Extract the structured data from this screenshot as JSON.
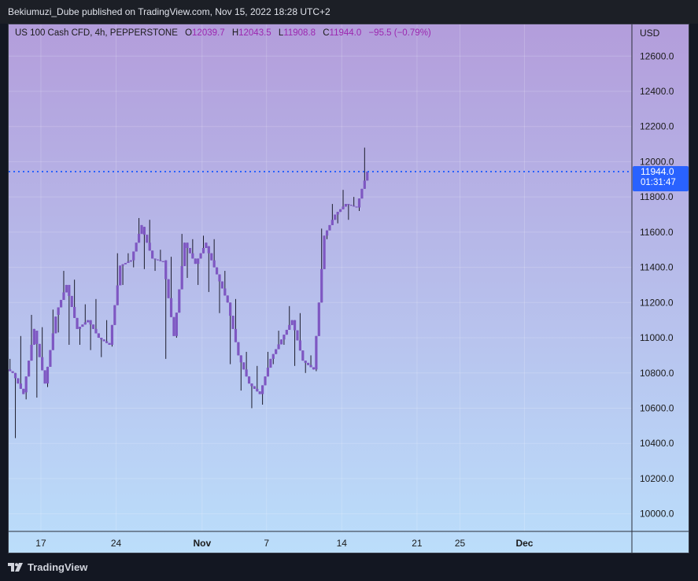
{
  "header": {
    "publisher": "Bekiumuzi_Dube published on TradingView.com, Nov 15, 2022 18:28 UTC+2"
  },
  "legend": {
    "symbol": "US 100 Cash CFD, 4h, PEPPERSTONE",
    "open_key": "O",
    "open": "12039.7",
    "high_key": "H",
    "high": "12043.5",
    "low_key": "L",
    "low": "11908.8",
    "close_key": "C",
    "close": "11944.0",
    "change": "−95.5 (−0.79%)"
  },
  "price_axis": {
    "currency": "USD",
    "last_price_label": "11944.0",
    "countdown_label": "01:31:47"
  },
  "footer": {
    "brand": "TradingView"
  },
  "colors": {
    "bg_top": "#b39ddb",
    "bg_bottom": "#bbdefb",
    "candle": "#7e57c2",
    "wick": "#1b1b2b",
    "last_price": "#2962ff",
    "legend_values": "#9c27b0"
  },
  "chart_data": {
    "type": "candlestick",
    "title": "US 100 Cash CFD, 4h, PEPPERSTONE",
    "ylabel": "USD",
    "ylim": [
      9900,
      12780
    ],
    "y_ticks": [
      10000,
      10200,
      10400,
      10600,
      10800,
      11000,
      11200,
      11400,
      11600,
      11800,
      12000,
      12200,
      12400,
      12600
    ],
    "x_ticks": [
      {
        "label": "17",
        "day": 17
      },
      {
        "label": "24",
        "day": 24
      },
      {
        "label": "Nov",
        "day": 32
      },
      {
        "label": "7",
        "day": 38
      },
      {
        "label": "14",
        "day": 45
      },
      {
        "label": "21",
        "day": 52
      },
      {
        "label": "25",
        "day": 56
      },
      {
        "label": "Dec",
        "day": 62
      }
    ],
    "grid": true,
    "last_price": 11944.0,
    "candles_daily_approx": [
      {
        "day": 14,
        "open": 10840,
        "high": 10880,
        "low": 10780,
        "close": 10800
      },
      {
        "day": 15,
        "open": 10800,
        "high": 11010,
        "low": 10430,
        "close": 10680
      },
      {
        "day": 16,
        "open": 10690,
        "high": 11130,
        "low": 10650,
        "close": 11050
      },
      {
        "day": 17,
        "open": 11040,
        "high": 11060,
        "low": 10660,
        "close": 10740
      },
      {
        "day": 18,
        "open": 10740,
        "high": 11160,
        "low": 10720,
        "close": 11120
      },
      {
        "day": 19,
        "open": 11130,
        "high": 11380,
        "low": 11030,
        "close": 11300
      },
      {
        "day": 20,
        "open": 11300,
        "high": 11330,
        "low": 10960,
        "close": 11050
      },
      {
        "day": 21,
        "open": 11050,
        "high": 11190,
        "low": 10960,
        "close": 11100
      },
      {
        "day": 22,
        "open": 11100,
        "high": 11220,
        "low": 10930,
        "close": 11000
      },
      {
        "day": 23,
        "open": 11000,
        "high": 11100,
        "low": 10890,
        "close": 10960
      },
      {
        "day": 24,
        "open": 10960,
        "high": 11480,
        "low": 10950,
        "close": 11410
      },
      {
        "day": 25,
        "open": 11410,
        "high": 11480,
        "low": 11300,
        "close": 11440
      },
      {
        "day": 26,
        "open": 11440,
        "high": 11680,
        "low": 11400,
        "close": 11640
      },
      {
        "day": 27,
        "open": 11630,
        "high": 11670,
        "low": 11390,
        "close": 11450
      },
      {
        "day": 28,
        "open": 11450,
        "high": 11500,
        "low": 11380,
        "close": 11430
      },
      {
        "day": 29,
        "open": 11440,
        "high": 11460,
        "low": 10880,
        "close": 11010
      },
      {
        "day": 30,
        "open": 11010,
        "high": 11590,
        "low": 11000,
        "close": 11540
      },
      {
        "day": 31,
        "open": 11540,
        "high": 11560,
        "low": 11340,
        "close": 11420
      },
      {
        "day": 32,
        "open": 11420,
        "high": 11580,
        "low": 11300,
        "close": 11540
      },
      {
        "day": 33,
        "open": 11520,
        "high": 11560,
        "low": 11260,
        "close": 11360
      },
      {
        "day": 34,
        "open": 11360,
        "high": 11380,
        "low": 11140,
        "close": 11200
      },
      {
        "day": 35,
        "open": 11200,
        "high": 11220,
        "low": 10850,
        "close": 10900
      },
      {
        "day": 36,
        "open": 10900,
        "high": 10920,
        "low": 10700,
        "close": 10740
      },
      {
        "day": 37,
        "open": 10740,
        "high": 10840,
        "low": 10600,
        "close": 10680
      },
      {
        "day": 38,
        "open": 10680,
        "high": 10920,
        "low": 10620,
        "close": 10880
      },
      {
        "day": 39,
        "open": 10880,
        "high": 11040,
        "low": 10850,
        "close": 10990
      },
      {
        "day": 40,
        "open": 10990,
        "high": 11180,
        "low": 10960,
        "close": 11100
      },
      {
        "day": 41,
        "open": 11100,
        "high": 11140,
        "low": 10840,
        "close": 10870
      },
      {
        "day": 42,
        "open": 10870,
        "high": 10900,
        "low": 10800,
        "close": 10820
      },
      {
        "day": 43,
        "open": 10820,
        "high": 11620,
        "low": 10810,
        "close": 11580
      },
      {
        "day": 44,
        "open": 11580,
        "high": 11760,
        "low": 11560,
        "close": 11700
      },
      {
        "day": 45,
        "open": 11700,
        "high": 11840,
        "low": 11650,
        "close": 11760
      },
      {
        "day": 46,
        "open": 11760,
        "high": 11800,
        "low": 11670,
        "close": 11740
      },
      {
        "day": 47,
        "open": 11740,
        "high": 12080,
        "low": 11720,
        "close": 11944
      }
    ]
  }
}
